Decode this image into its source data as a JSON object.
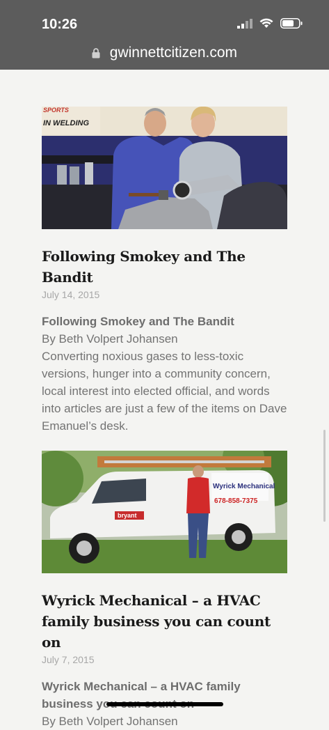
{
  "status": {
    "time": "10:26"
  },
  "browser": {
    "url": "gwinnettcitizen.com"
  },
  "articles": [
    {
      "title": "Following Smokey and The Bandit",
      "date": "July 14, 2015",
      "subhead": "Following Smokey and The Bandit",
      "byline": "By Beth Volpert Johansen",
      "excerpt": "Converting noxious gases to less-toxic versions, hunger into a community concern, local interest into elected official, and words into articles are just a few of the items on Dave Emanuel’s desk.",
      "photo": {
        "sign_text": "IN WELDING",
        "sign_top": "SPORTS"
      }
    },
    {
      "title": "Wyrick Mechanical – a HVAC family business you can count on",
      "date": "July 7, 2015",
      "subhead": "Wyrick Mechanical – a HVAC family business you can count on",
      "byline": "By Beth Volpert Johansen",
      "photo": {
        "van_brand": "Wyrick Mechanical",
        "van_phone": "678-858-7375",
        "van_badge": "bryant"
      }
    }
  ],
  "colors": {
    "status_bg": "#5c5c5c",
    "page_bg": "#f4f4f2",
    "title": "#1a1a1a",
    "meta": "#a7a7a7"
  }
}
